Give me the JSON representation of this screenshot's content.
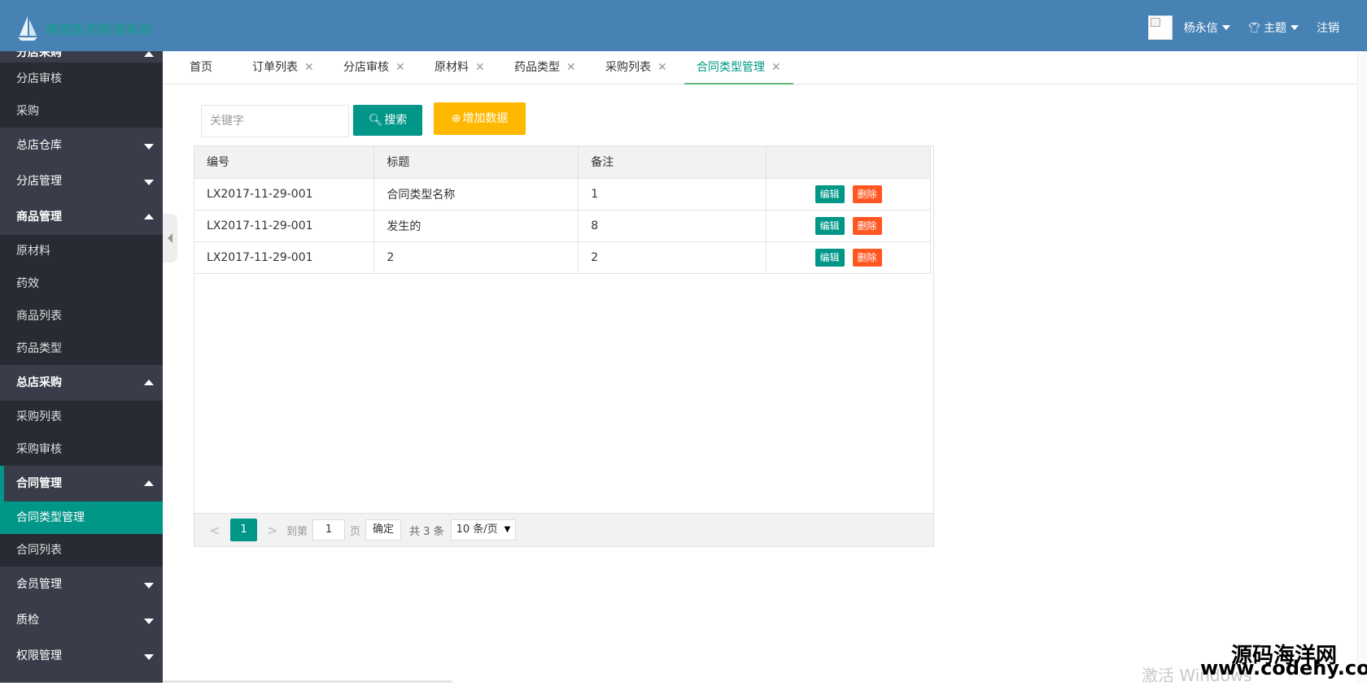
{
  "header": {
    "app_title": "康捷医药管理系统",
    "user_name": "杨永信",
    "theme_label": "主题",
    "logout_label": "注销"
  },
  "sidebar": {
    "items": [
      {
        "label": "分店采购",
        "type": "group",
        "expanded": true
      },
      {
        "label": "分店审核",
        "type": "sub"
      },
      {
        "label": "采购",
        "type": "sub"
      },
      {
        "label": "总店仓库",
        "type": "group",
        "expanded": false
      },
      {
        "label": "分店管理",
        "type": "group",
        "expanded": false
      },
      {
        "label": "商品管理",
        "type": "group",
        "expanded": true
      },
      {
        "label": "原材料",
        "type": "sub"
      },
      {
        "label": "药效",
        "type": "sub"
      },
      {
        "label": "商品列表",
        "type": "sub"
      },
      {
        "label": "药品类型",
        "type": "sub"
      },
      {
        "label": "总店采购",
        "type": "group",
        "expanded": true
      },
      {
        "label": "采购列表",
        "type": "sub"
      },
      {
        "label": "采购审核",
        "type": "sub"
      },
      {
        "label": "合同管理",
        "type": "group",
        "expanded": true
      },
      {
        "label": "合同类型管理",
        "type": "sub",
        "selected": true
      },
      {
        "label": "合同列表",
        "type": "sub"
      },
      {
        "label": "会员管理",
        "type": "group",
        "expanded": false
      },
      {
        "label": "质检",
        "type": "group",
        "expanded": false
      },
      {
        "label": "权限管理",
        "type": "group",
        "expanded": false
      }
    ]
  },
  "tabs": [
    {
      "label": "首页",
      "closable": false
    },
    {
      "label": "订单列表",
      "closable": true
    },
    {
      "label": "分店审核",
      "closable": true
    },
    {
      "label": "原材料",
      "closable": true
    },
    {
      "label": "药品类型",
      "closable": true
    },
    {
      "label": "采购列表",
      "closable": true
    },
    {
      "label": "合同类型管理",
      "closable": true,
      "active": true
    }
  ],
  "toolbar": {
    "search_placeholder": "关键字",
    "search_label": "搜索",
    "add_label": "增加数据"
  },
  "table": {
    "headers": [
      "编号",
      "标题",
      "备注",
      ""
    ],
    "rows": [
      {
        "id": "LX2017-11-29-001",
        "title": "合同类型名称",
        "note": "1"
      },
      {
        "id": "LX2017-11-29-001",
        "title": "发生的",
        "note": "8"
      },
      {
        "id": "LX2017-11-29-001",
        "title": "2",
        "note": "2"
      }
    ],
    "edit_label": "编辑",
    "delete_label": "删除"
  },
  "pager": {
    "prev": "<",
    "current_page": "1",
    "next": ">",
    "goto_label": "到第",
    "goto_value": "1",
    "page_unit": "页",
    "confirm_label": "确定",
    "total_label": "共 3 条",
    "page_size": "10 条/页"
  },
  "overlay": {
    "windows_watermark": "激活 Windows",
    "site_name": "源码海洋网",
    "site_url": "www.codehy.com"
  },
  "colors": {
    "header_bg": "#4682b4",
    "sidebar_bg": "#393d49",
    "sidebar_sub_bg": "#282b33",
    "accent": "#009688",
    "add_button": "#ffb800",
    "delete_button": "#ff5722"
  }
}
